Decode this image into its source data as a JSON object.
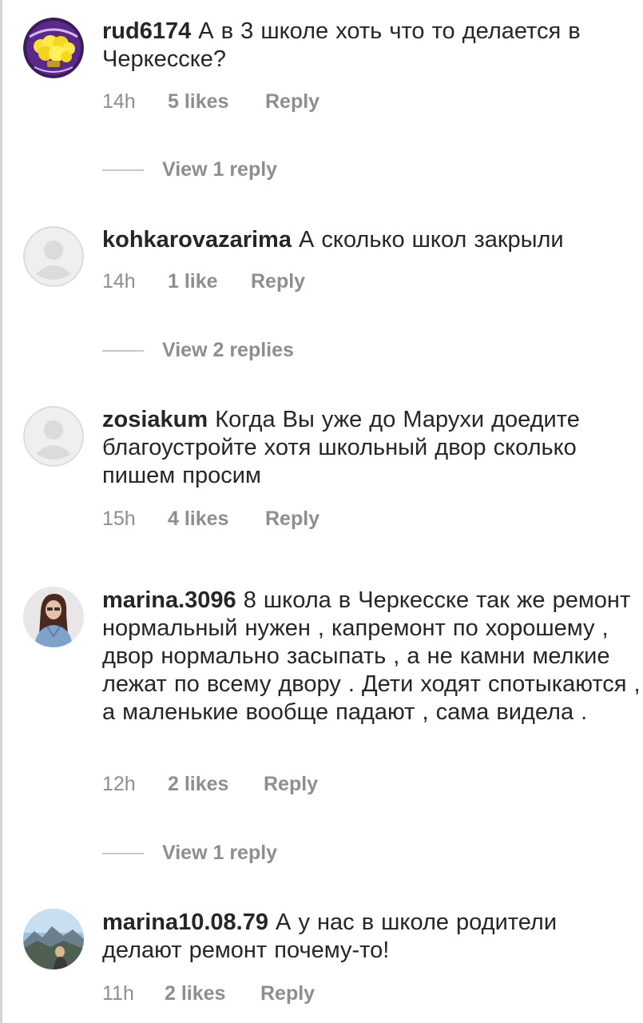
{
  "comments": [
    {
      "username": "rud6174",
      "text": "А в 3 школе хоть что то делается в Черкесске?",
      "time": "14h",
      "likes": "5 likes",
      "reply": "Reply",
      "view_replies": "View 1 reply",
      "avatar": "yellow-flowers-avatar"
    },
    {
      "username": "kohkarovazarima",
      "text": "А сколько школ закрыли",
      "time": "14h",
      "likes": "1 like",
      "reply": "Reply",
      "view_replies": "View 2 replies",
      "avatar": "default-user-avatar"
    },
    {
      "username": "zosiakum",
      "text": "Когда Вы уже до Марухи доедите благоустройте хотя  школьный  двор сколько пишем просим",
      "time": "15h",
      "likes": "4 likes",
      "reply": "Reply",
      "avatar": "default-user-avatar"
    },
    {
      "username": "marina.3096",
      "text": "8 школа в Черкесске так же ремонт нормальный нужен , капремонт по хорошему , двор нормально засыпать , а не камни мелкие лежат по всему двору . Дети ходят спотыкаются , а маленькие  вообще падают , сама видела .",
      "time": "12h",
      "likes": "2 likes",
      "reply": "Reply",
      "view_replies": "View 1 reply",
      "avatar": "girl-photo-avatar"
    },
    {
      "username": "marina10.08.79",
      "text": "А у нас в школе родители делают ремонт почему-то!",
      "time": "11h",
      "likes": "2 likes",
      "reply": "Reply",
      "avatar": "mountain-photo-avatar"
    }
  ],
  "colors": {
    "text": "#262626",
    "secondary": "#8e8e8e",
    "divider": "#c7c7c7",
    "avatar_placeholder": "#dbdbdb"
  }
}
